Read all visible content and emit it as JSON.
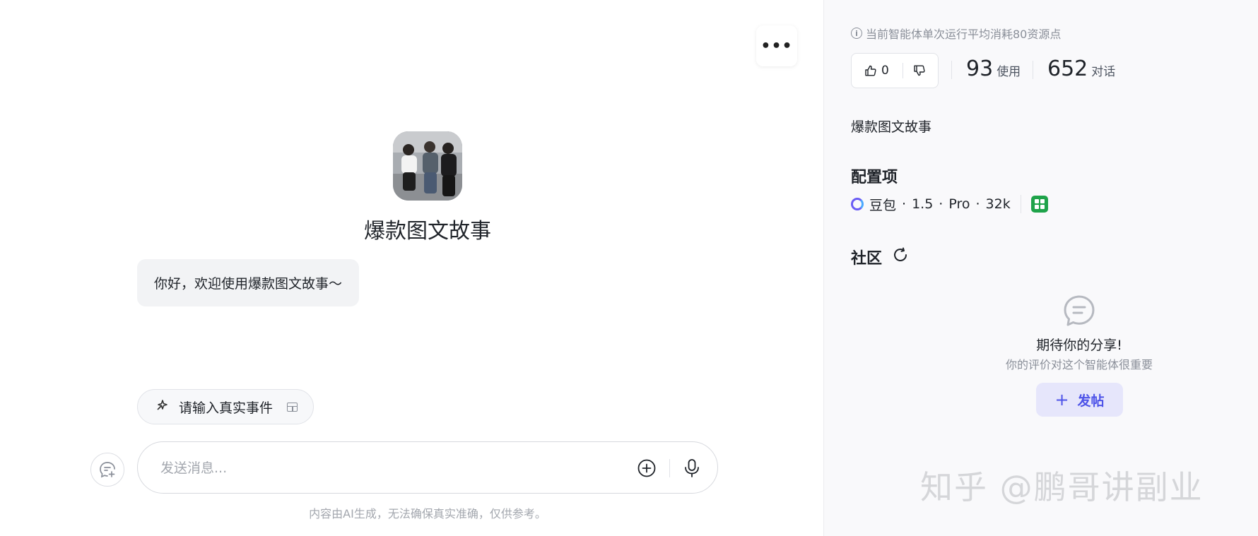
{
  "header": {
    "more_icon": "more-horizontal-icon",
    "more_label": "•••"
  },
  "bot": {
    "avatar_icon": "bot-avatar-photo",
    "title": "爆款图文故事",
    "greeting": "你好，欢迎使用爆款图文故事～"
  },
  "suggestion": {
    "icon": "sparkle-icon",
    "label": "请输入真实事件",
    "tail_icon": "template-icon"
  },
  "composer": {
    "new_chat_icon": "new-chat-icon",
    "placeholder": "发送消息...",
    "add_icon": "plus-circle-icon",
    "mic_icon": "microphone-icon",
    "disclaimer": "内容由AI生成，无法确保真实准确，仅供参考。"
  },
  "sidebar": {
    "cost_notice": "当前智能体单次运行平均消耗80资源点",
    "likes": "0",
    "usage": {
      "value": "93",
      "label": "使用"
    },
    "conversations": {
      "value": "652",
      "label": "对话"
    },
    "bot_name": "爆款图文故事",
    "config_title": "配置项",
    "model": {
      "name": "豆包",
      "version": "1.5",
      "tier": "Pro",
      "context": "32k",
      "dot": "·"
    },
    "community_title": "社区",
    "empty_title": "期待你的分享!",
    "empty_subtitle": "你的评价对这个智能体很重要",
    "post_button": "发帖",
    "post_plus": "+"
  },
  "watermark": "知乎 @鹏哥讲副业",
  "colors": {
    "accent": "#4d53e8",
    "accent_bg": "#e6e6fb",
    "sidebar_bg": "#f9f9fb",
    "plugin": "#1fa34a"
  }
}
